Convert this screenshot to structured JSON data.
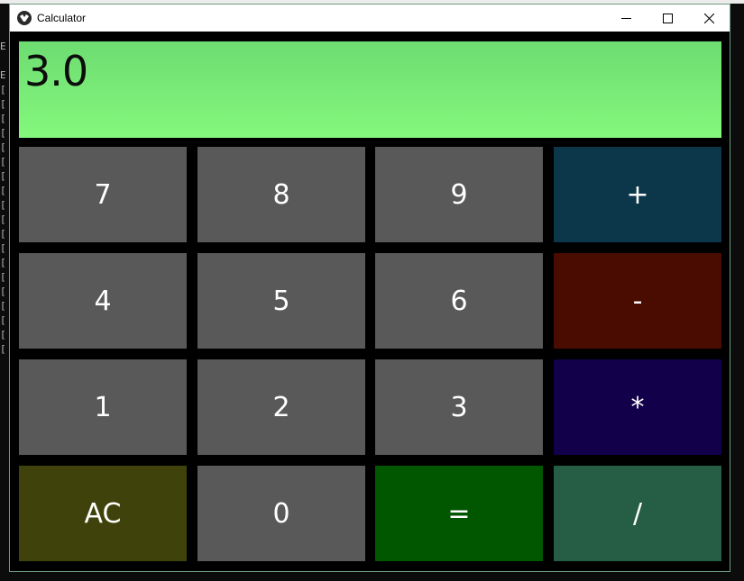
{
  "window": {
    "title": "Calculator"
  },
  "background_console": {
    "lines": "E\n\nE\n[\n[\n[\n[\n[\n[\n[\n[\n[\n[\n[\n[\n[\n[\n[\n[\n[\n[\n["
  },
  "display": {
    "value": "3.0"
  },
  "keypad": {
    "keys": [
      {
        "label": "7",
        "color": "#595959"
      },
      {
        "label": "8",
        "color": "#595959"
      },
      {
        "label": "9",
        "color": "#595959"
      },
      {
        "label": "+",
        "color": "#0c364a"
      },
      {
        "label": "4",
        "color": "#595959"
      },
      {
        "label": "5",
        "color": "#595959"
      },
      {
        "label": "6",
        "color": "#595959"
      },
      {
        "label": "-",
        "color": "#4a0b00"
      },
      {
        "label": "1",
        "color": "#595959"
      },
      {
        "label": "2",
        "color": "#595959"
      },
      {
        "label": "3",
        "color": "#595959"
      },
      {
        "label": "*",
        "color": "#13004a"
      },
      {
        "label": "AC",
        "color": "#3f430b"
      },
      {
        "label": "0",
        "color": "#595959"
      },
      {
        "label": "=",
        "color": "#005700"
      },
      {
        "label": "/",
        "color": "#265d45"
      }
    ]
  }
}
